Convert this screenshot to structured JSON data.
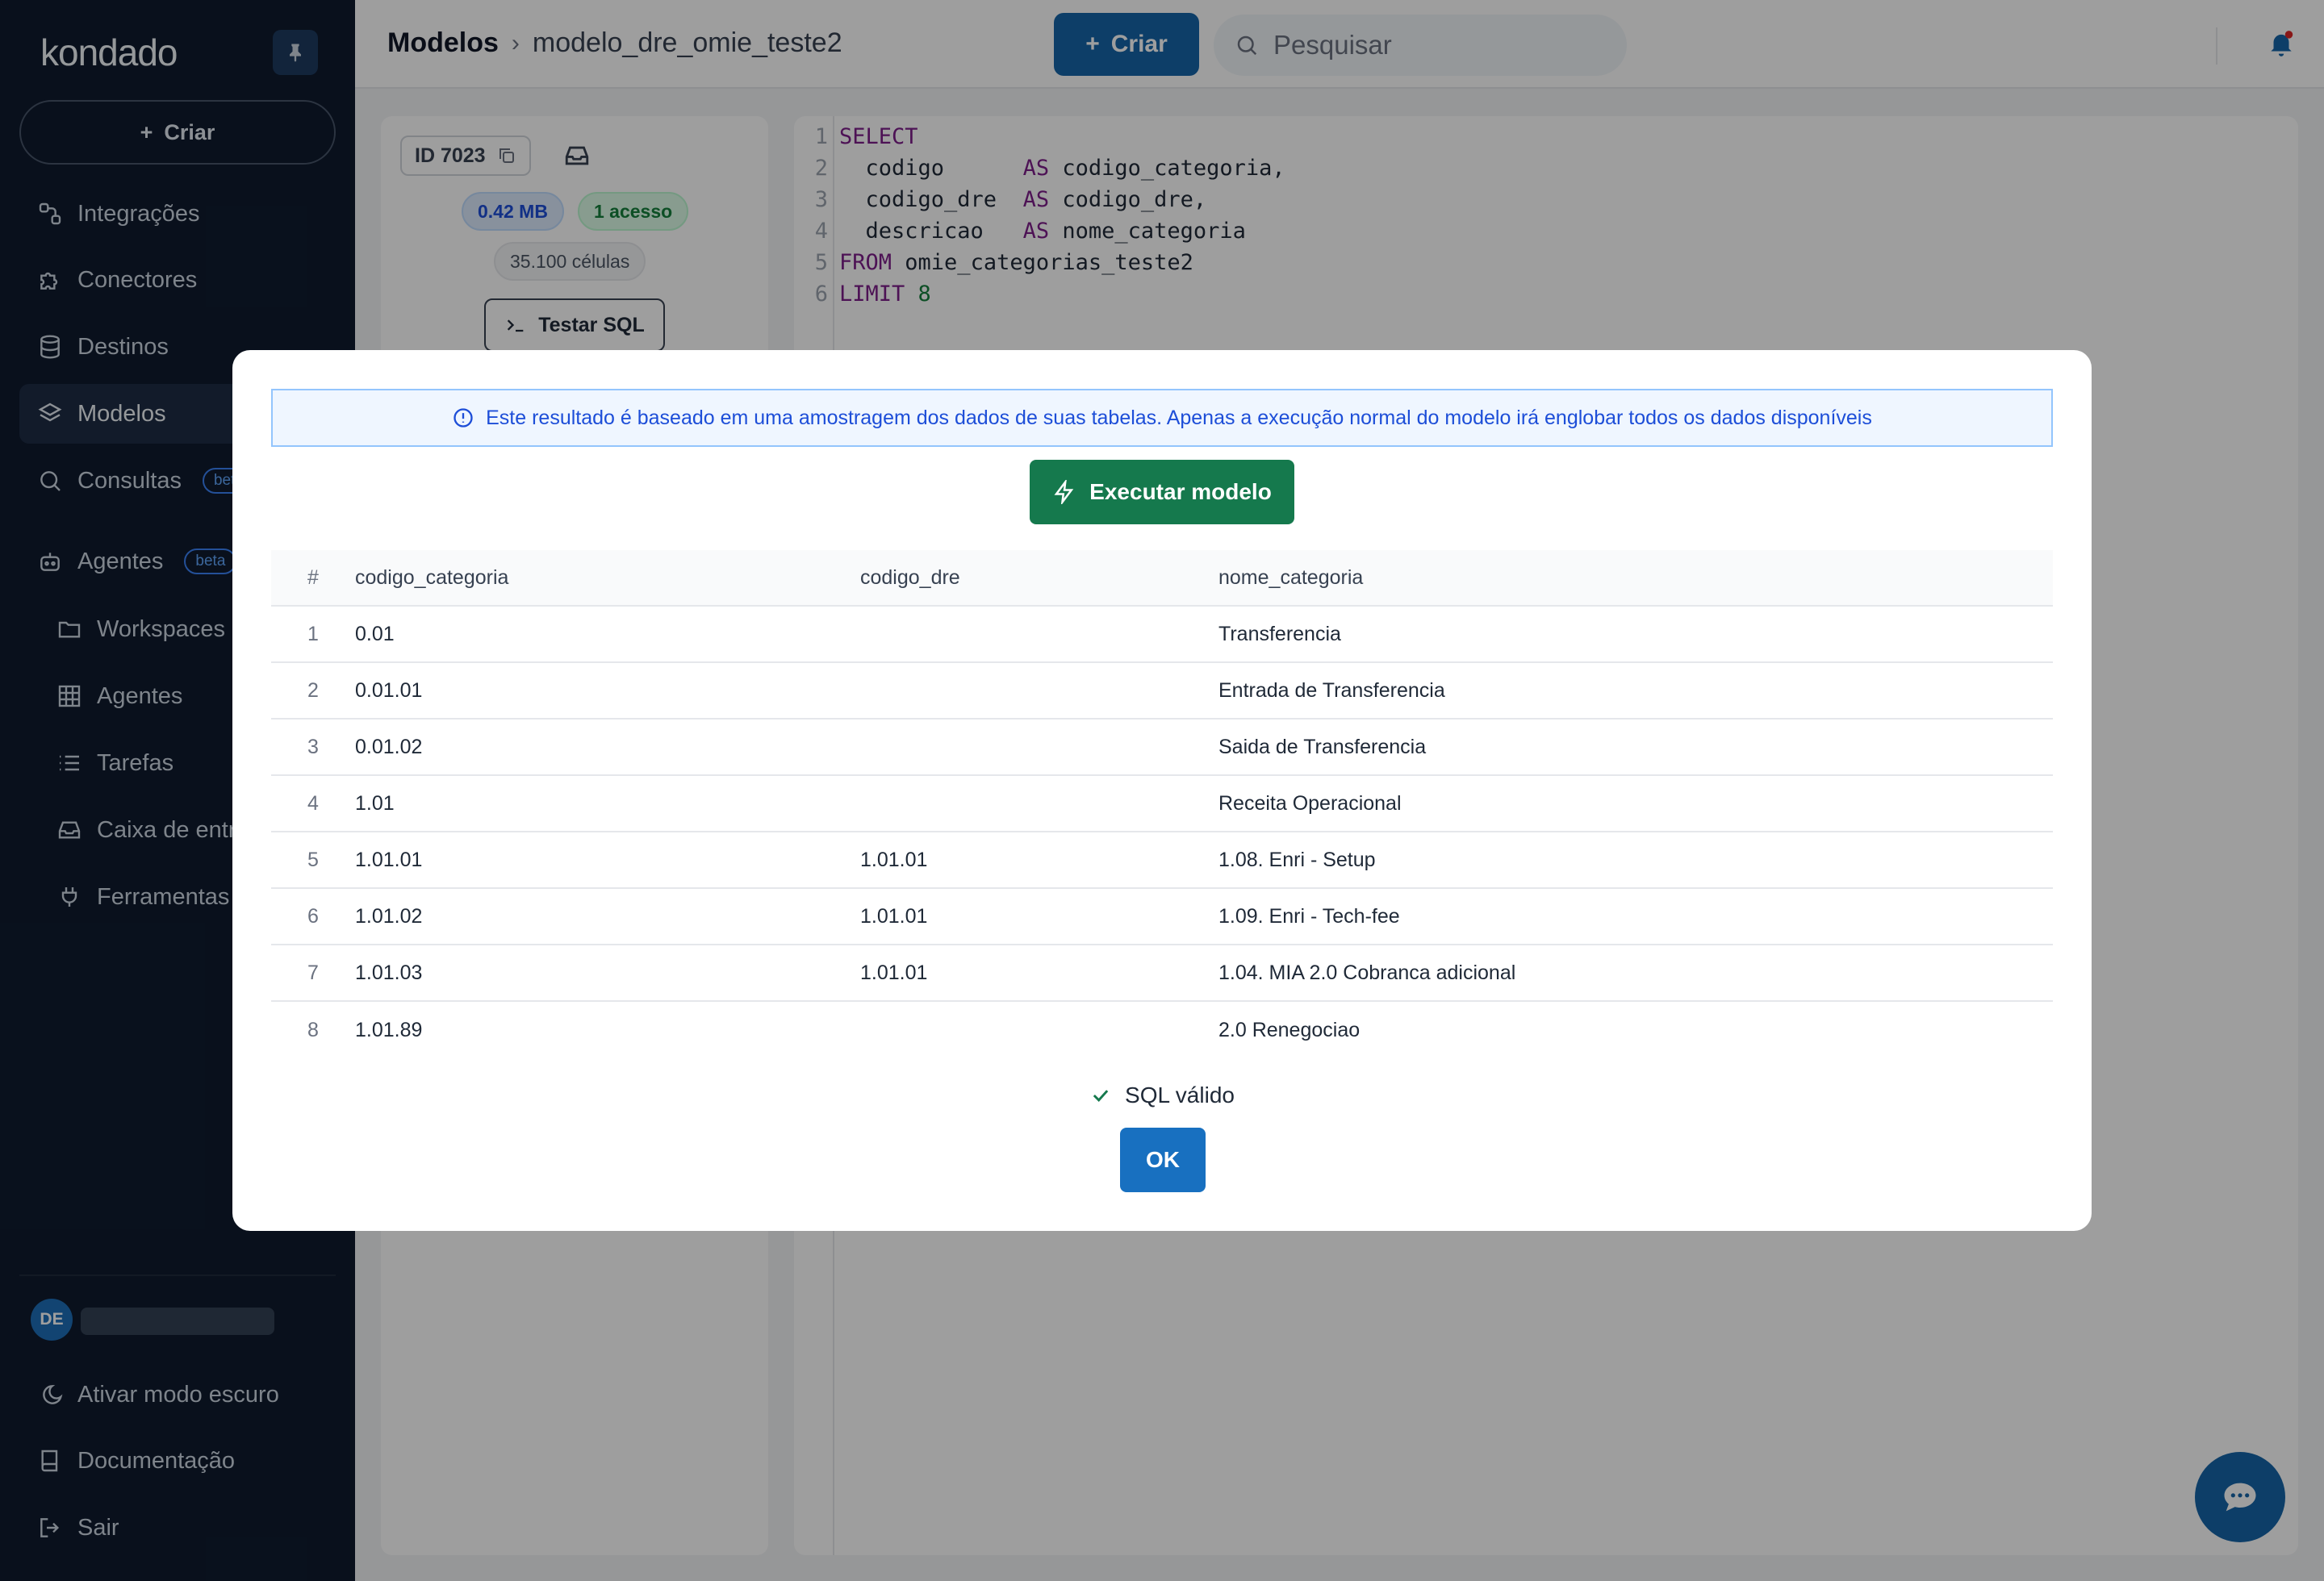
{
  "sidebar": {
    "logo": "kondado",
    "create_label": "Criar",
    "items": [
      {
        "label": "Integrações",
        "icon": "integrations-icon"
      },
      {
        "label": "Conectores",
        "icon": "puzzle-icon"
      },
      {
        "label": "Destinos",
        "icon": "database-icon"
      },
      {
        "label": "Modelos",
        "icon": "layers-icon",
        "active": true
      },
      {
        "label": "Consultas",
        "icon": "search-icon",
        "badge": "beta"
      },
      {
        "label": "Agentes",
        "icon": "robot-icon",
        "badge": "beta"
      }
    ],
    "sub_items": [
      {
        "label": "Workspaces",
        "icon": "folder-icon"
      },
      {
        "label": "Agentes",
        "icon": "grid-icon"
      },
      {
        "label": "Tarefas",
        "icon": "list-icon"
      },
      {
        "label": "Caixa de entr",
        "icon": "inbox-icon"
      },
      {
        "label": "Ferramentas",
        "icon": "plug-icon"
      }
    ],
    "user_initials": "DE",
    "dark_mode_label": "Ativar modo escuro",
    "docs_label": "Documentação",
    "logout_label": "Sair"
  },
  "topbar": {
    "breadcrumb_root": "Modelos",
    "breadcrumb_sep": "›",
    "breadcrumb_page": "modelo_dre_omie_teste2",
    "create_label": "Criar",
    "search_placeholder": "Pesquisar"
  },
  "model_info": {
    "id_label": "ID 7023",
    "size": "0.42 MB",
    "access": "1 acesso",
    "cells": "35.100 células",
    "test_sql_label": "Testar SQL"
  },
  "editor": {
    "lines": [
      {
        "n": "1",
        "kw": "SELECT",
        "text": "",
        "tail": ""
      },
      {
        "n": "2",
        "kw": "",
        "text": "  codigo      ",
        "kw2": "AS",
        "tail": " codigo_categoria,"
      },
      {
        "n": "3",
        "kw": "",
        "text": "  codigo_dre  ",
        "kw2": "AS",
        "tail": " codigo_dre,"
      },
      {
        "n": "4",
        "kw": "",
        "text": "  descricao   ",
        "kw2": "AS",
        "tail": " nome_categoria"
      },
      {
        "n": "5",
        "kw": "FROM",
        "text": " omie_categorias_teste2",
        "tail": ""
      },
      {
        "n": "6",
        "kw": "LIMIT",
        "text": " ",
        "num": "8",
        "tail": ""
      }
    ]
  },
  "modal": {
    "notice": "Este resultado é baseado em uma amostragem dos dados de suas tabelas. Apenas a execução normal do modelo irá englobar todos os dados disponíveis",
    "execute_label": "Executar modelo",
    "columns": [
      "#",
      "codigo_categoria",
      "codigo_dre",
      "nome_categoria"
    ],
    "rows": [
      [
        "1",
        "0.01",
        "",
        "Transferencia"
      ],
      [
        "2",
        "0.01.01",
        "",
        "Entrada de Transferencia"
      ],
      [
        "3",
        "0.01.02",
        "",
        "Saida de Transferencia"
      ],
      [
        "4",
        "1.01",
        "",
        "Receita Operacional"
      ],
      [
        "5",
        "1.01.01",
        "1.01.01",
        "1.08. Enri - Setup"
      ],
      [
        "6",
        "1.01.02",
        "1.01.01",
        "1.09. Enri - Tech-fee"
      ],
      [
        "7",
        "1.01.03",
        "1.01.01",
        "1.04. MIA 2.0 Cobranca adicional"
      ],
      [
        "8",
        "1.01.89",
        "",
        "2.0 Renegociao"
      ]
    ],
    "valid_label": "SQL válido",
    "ok_label": "OK"
  },
  "colors": {
    "sidebar_bg": "#0f1b2e",
    "primary": "#1565a8",
    "execute_green": "#15794d",
    "notice_blue": "#1d4ed8"
  }
}
